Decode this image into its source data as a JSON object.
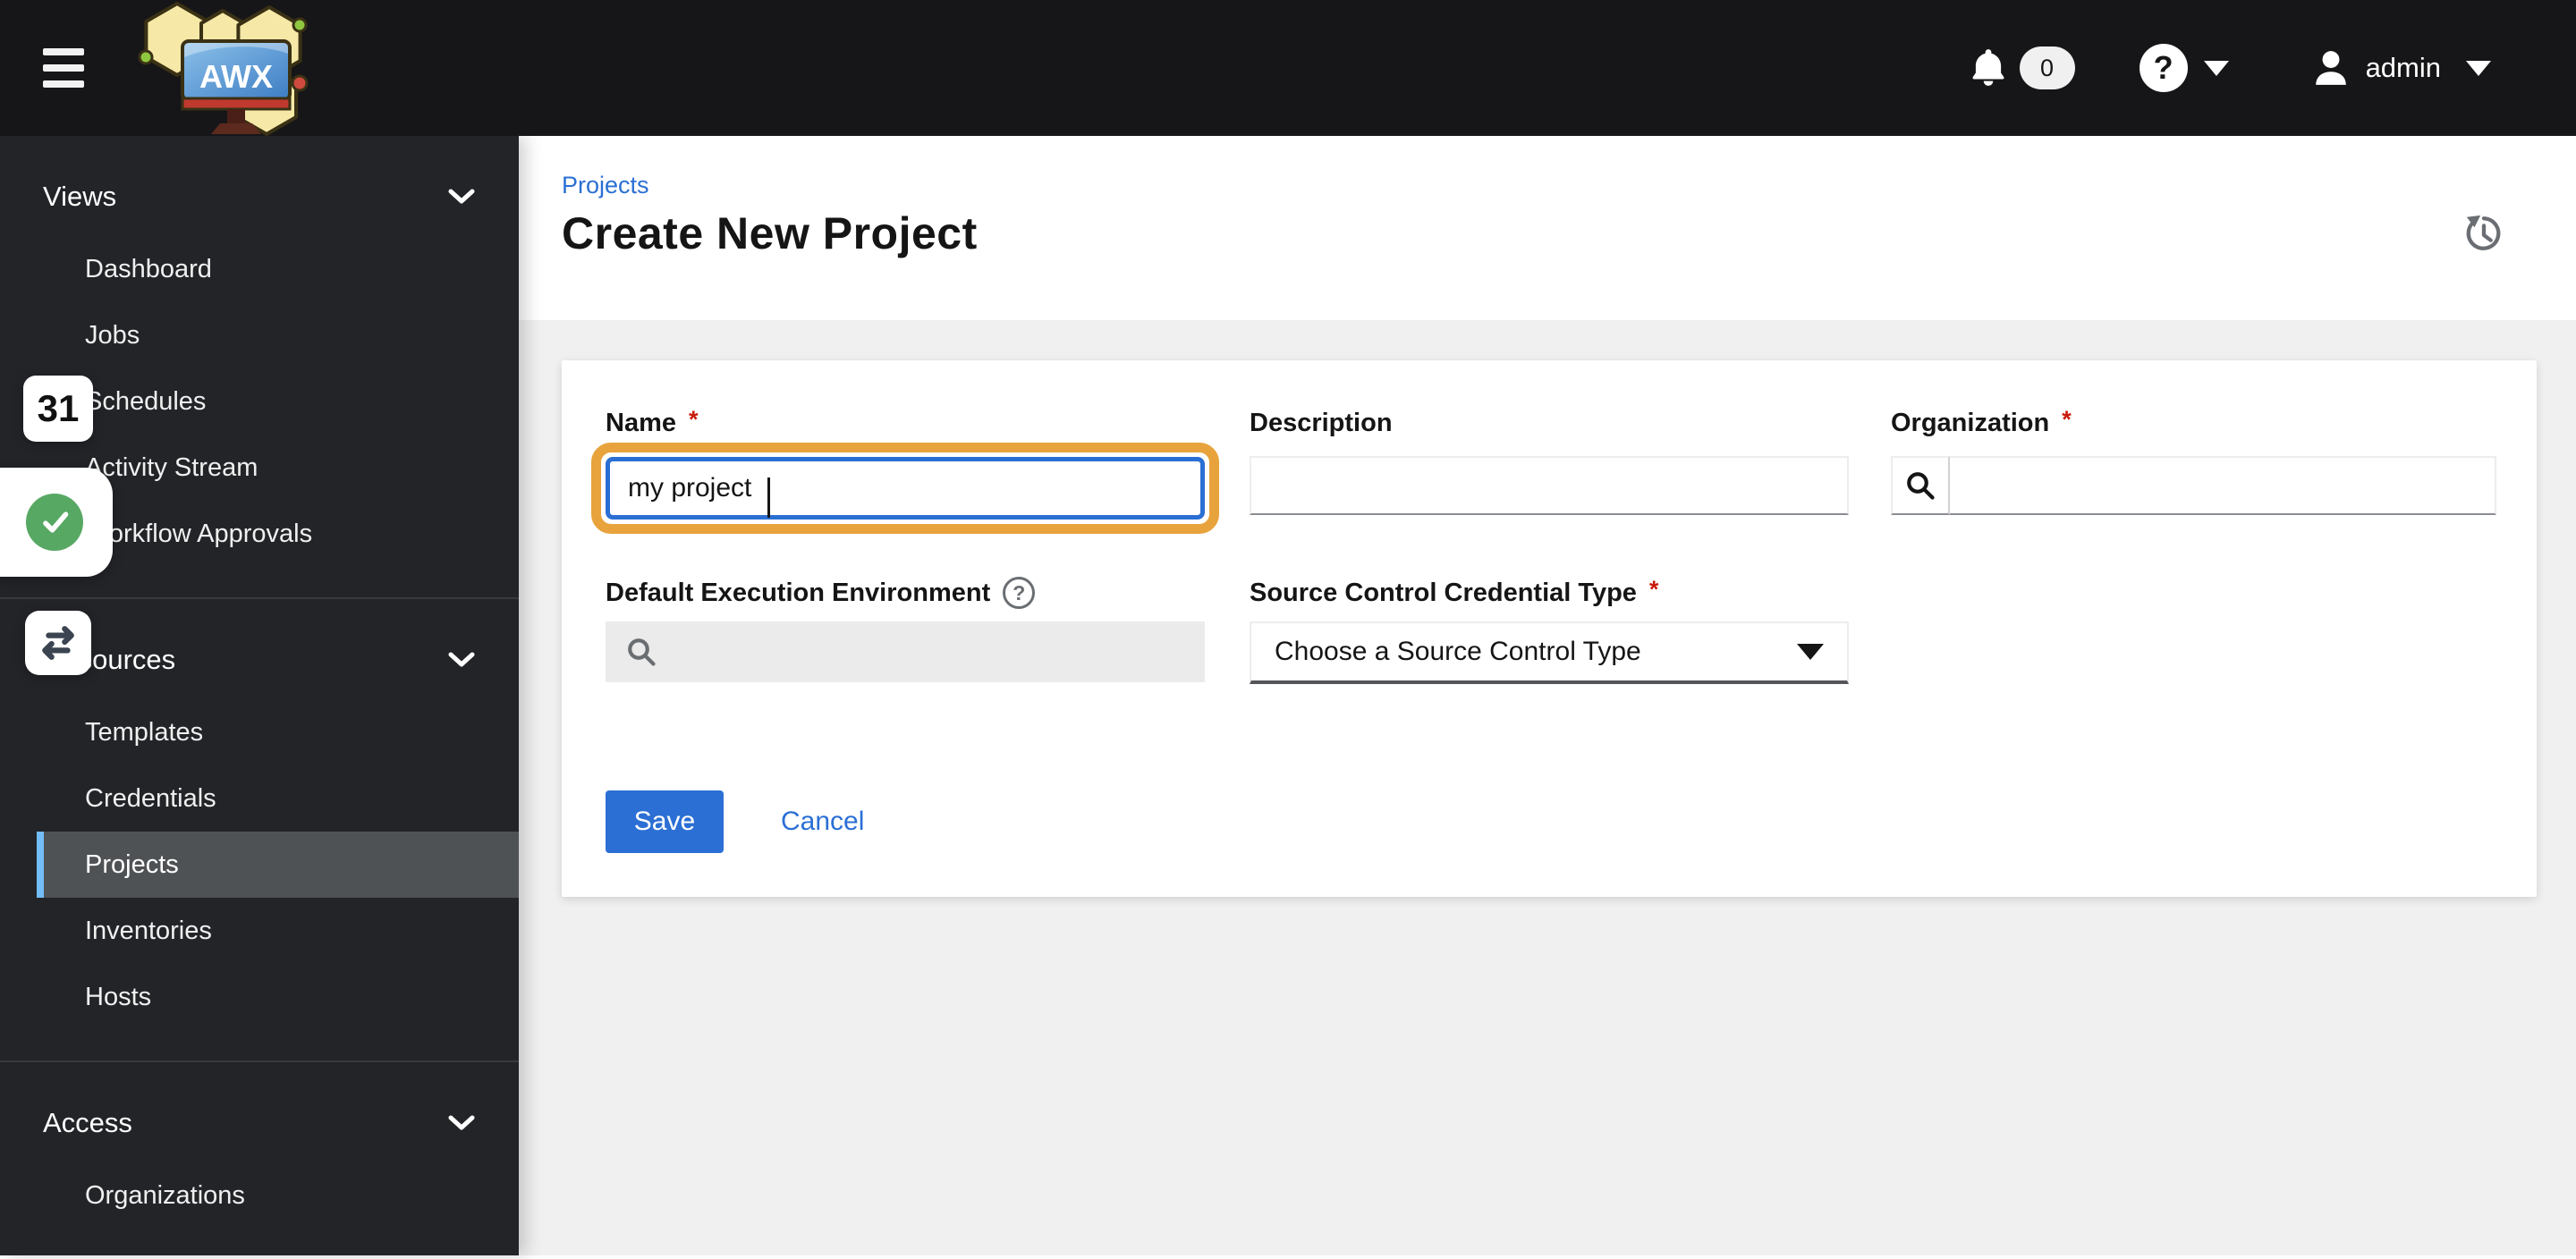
{
  "brand": {
    "logo_text": "AWX"
  },
  "topbar": {
    "notifications_count": "0",
    "help_glyph": "?",
    "user": "admin"
  },
  "sidebar": {
    "groups": [
      {
        "label": "Views",
        "items": [
          {
            "label": "Dashboard"
          },
          {
            "label": "Jobs"
          },
          {
            "label": "Schedules"
          },
          {
            "label": "Activity Stream"
          },
          {
            "label": "Workflow Approvals"
          }
        ]
      },
      {
        "label": "Resources",
        "items": [
          {
            "label": "Templates"
          },
          {
            "label": "Credentials"
          },
          {
            "label": "Projects",
            "active": true
          },
          {
            "label": "Inventories"
          },
          {
            "label": "Hosts"
          }
        ]
      },
      {
        "label": "Access",
        "items": [
          {
            "label": "Organizations"
          }
        ]
      }
    ]
  },
  "page": {
    "breadcrumb": "Projects",
    "title": "Create New Project"
  },
  "form": {
    "name": {
      "label": "Name",
      "required": "*",
      "value": "my project"
    },
    "description": {
      "label": "Description",
      "value": ""
    },
    "organization": {
      "label": "Organization",
      "required": "*",
      "value": ""
    },
    "default_execution_environment": {
      "label": "Default Execution Environment",
      "value": ""
    },
    "source_control_credential_type": {
      "label": "Source Control Credential Type",
      "required": "*",
      "selected": "Choose a Source Control Type"
    },
    "save_label": "Save",
    "cancel_label": "Cancel"
  },
  "overlays": {
    "counter": "31"
  },
  "icons": {
    "menu": "hamburger",
    "notifications": "bell",
    "help": "question-circle",
    "user": "person",
    "group_toggle": "chevron-down",
    "dropdown": "caret-down",
    "search": "magnifier",
    "field_help": "question-circle-outline",
    "history": "history-clock",
    "overlay_check": "check-circle",
    "overlay_swap": "swap-arrows"
  },
  "colors": {
    "topbar_bg": "#161618",
    "sidebar_bg": "#222428",
    "active_item_bg": "#4f5255",
    "active_item_bar": "#73bcf7",
    "accent_blue": "#2b6fd4",
    "focus_ring_orange": "#e8a33d",
    "required_red": "#c9190b",
    "page_bg": "#f0f0f0",
    "card_bg": "#ffffff",
    "success_green": "#57a863",
    "muted_gray": "#6a6e73"
  }
}
